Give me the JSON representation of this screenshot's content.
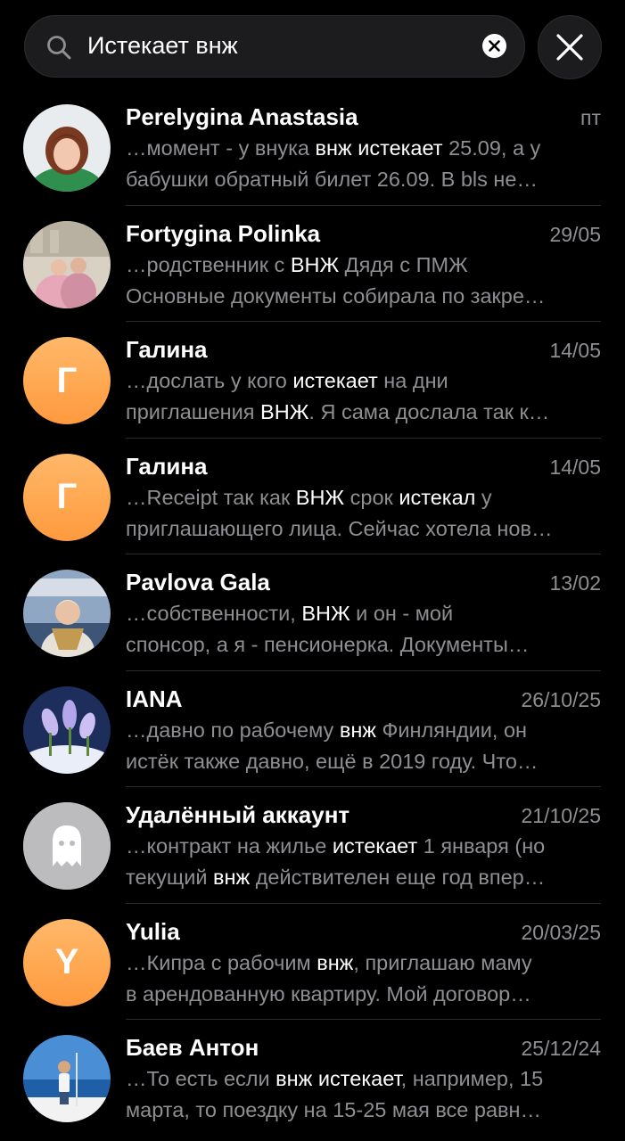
{
  "search": {
    "query": "Истекает внж"
  },
  "results": [
    {
      "name": "Perelygina Anastasia",
      "date": "пт",
      "avatar": {
        "type": "photo",
        "subject": "woman portrait"
      },
      "line1": [
        {
          "t": "…момент - у внука ",
          "h": false
        },
        {
          "t": "внж",
          "h": true
        },
        {
          "t": " ",
          "h": false
        },
        {
          "t": "истекает",
          "h": true
        },
        {
          "t": " 25.09, а у",
          "h": false
        }
      ],
      "line2": [
        {
          "t": "бабушки обратный билет 26.09. В bls не…",
          "h": false
        }
      ]
    },
    {
      "name": "Fortygina Polinka",
      "date": "29/05",
      "avatar": {
        "type": "photo",
        "subject": "women by building"
      },
      "line1": [
        {
          "t": "…родственник с ",
          "h": false
        },
        {
          "t": "ВНЖ",
          "h": true
        },
        {
          "t": " Дядя с ПМЖ",
          "h": false
        }
      ],
      "line2": [
        {
          "t": "Основные документы собирала по закре…",
          "h": false
        }
      ]
    },
    {
      "name": "Галина",
      "date": "14/05",
      "avatar": {
        "type": "letter",
        "letter": "Г"
      },
      "line1": [
        {
          "t": "…дослать у кого ",
          "h": false
        },
        {
          "t": "истекает",
          "h": true
        },
        {
          "t": " на дни",
          "h": false
        }
      ],
      "line2": [
        {
          "t": "приглашения ",
          "h": false
        },
        {
          "t": "ВНЖ",
          "h": true
        },
        {
          "t": ". Я сама дослала так к…",
          "h": false
        }
      ]
    },
    {
      "name": "Галина",
      "date": "14/05",
      "avatar": {
        "type": "letter",
        "letter": "Г"
      },
      "line1": [
        {
          "t": "…Receipt так как ",
          "h": false
        },
        {
          "t": "ВНЖ",
          "h": true
        },
        {
          "t": " срок ",
          "h": false
        },
        {
          "t": "истекал",
          "h": true
        },
        {
          "t": " у",
          "h": false
        }
      ],
      "line2": [
        {
          "t": "приглашающего лица. Сейчас хотела нов…",
          "h": false
        }
      ]
    },
    {
      "name": "Pavlova Gala",
      "date": "13/02",
      "avatar": {
        "type": "photo",
        "subject": "woman in scarf"
      },
      "line1": [
        {
          "t": "…собственности, ",
          "h": false
        },
        {
          "t": "ВНЖ",
          "h": true
        },
        {
          "t": " и он - мой",
          "h": false
        }
      ],
      "line2": [
        {
          "t": "спонсор, а я - пенсионерка. Документы…",
          "h": false
        }
      ]
    },
    {
      "name": "IANA",
      "date": "26/10/25",
      "avatar": {
        "type": "photo",
        "subject": "crocus flowers"
      },
      "line1": [
        {
          "t": "…давно по рабочему ",
          "h": false
        },
        {
          "t": "внж",
          "h": true
        },
        {
          "t": " Финляндии, он",
          "h": false
        }
      ],
      "line2": [
        {
          "t": "истёк также давно, ещё в 2019 году. Что…",
          "h": false
        }
      ]
    },
    {
      "name": "Удалённый аккаунт",
      "date": "21/10/25",
      "avatar": {
        "type": "deleted",
        "icon": "ghost-icon"
      },
      "line1": [
        {
          "t": "…контракт на жилье ",
          "h": false
        },
        {
          "t": "истекает",
          "h": true
        },
        {
          "t": " 1 января (но",
          "h": false
        }
      ],
      "line2": [
        {
          "t": "текущий ",
          "h": false
        },
        {
          "t": "внж",
          "h": true
        },
        {
          "t": " действителен еще год впер…",
          "h": false
        }
      ]
    },
    {
      "name": "Yulia",
      "date": "20/03/25",
      "avatar": {
        "type": "letter",
        "letter": "Y"
      },
      "line1": [
        {
          "t": "…Кипра с рабочим ",
          "h": false
        },
        {
          "t": "внж",
          "h": true
        },
        {
          "t": ", приглашаю маму",
          "h": false
        }
      ],
      "line2": [
        {
          "t": "в арендованную квартиру. Мой договор…",
          "h": false
        }
      ]
    },
    {
      "name": "Баев Антон",
      "date": "25/12/24",
      "avatar": {
        "type": "photo",
        "subject": "man on boat"
      },
      "line1": [
        {
          "t": "…То есть если ",
          "h": false
        },
        {
          "t": "внж",
          "h": true
        },
        {
          "t": " ",
          "h": false
        },
        {
          "t": "истекает",
          "h": true
        },
        {
          "t": ", например, 15",
          "h": false
        }
      ],
      "line2": [
        {
          "t": "марта, то поездку на 15-25 мая все равн…",
          "h": false
        }
      ]
    }
  ]
}
